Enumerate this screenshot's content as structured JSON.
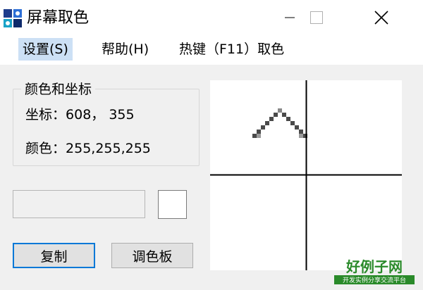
{
  "window": {
    "title": "屏幕取色",
    "app_icon": "color-picker-icon",
    "controls": [
      "minimize-icon",
      "maximize-icon",
      "close-icon"
    ]
  },
  "menu": {
    "settings": "设置(S)",
    "help": "帮助(H)",
    "hotkey": "热键（F11）取色"
  },
  "info": {
    "group_title": "颜色和坐标",
    "coord_label": "坐标：",
    "coord_value": "608， 355",
    "color_label": "颜色：",
    "color_value": "255,255,255"
  },
  "hex_field": {
    "value": ""
  },
  "swatch": {
    "color": "#ffffff"
  },
  "buttons": {
    "copy": "复制",
    "palette": "调色板"
  },
  "magnifier": {
    "background": "#ffffff",
    "crosshair_color": "#000000"
  },
  "watermark": {
    "brand": "好例子网",
    "tagline": "开发实例分享交流平台"
  }
}
